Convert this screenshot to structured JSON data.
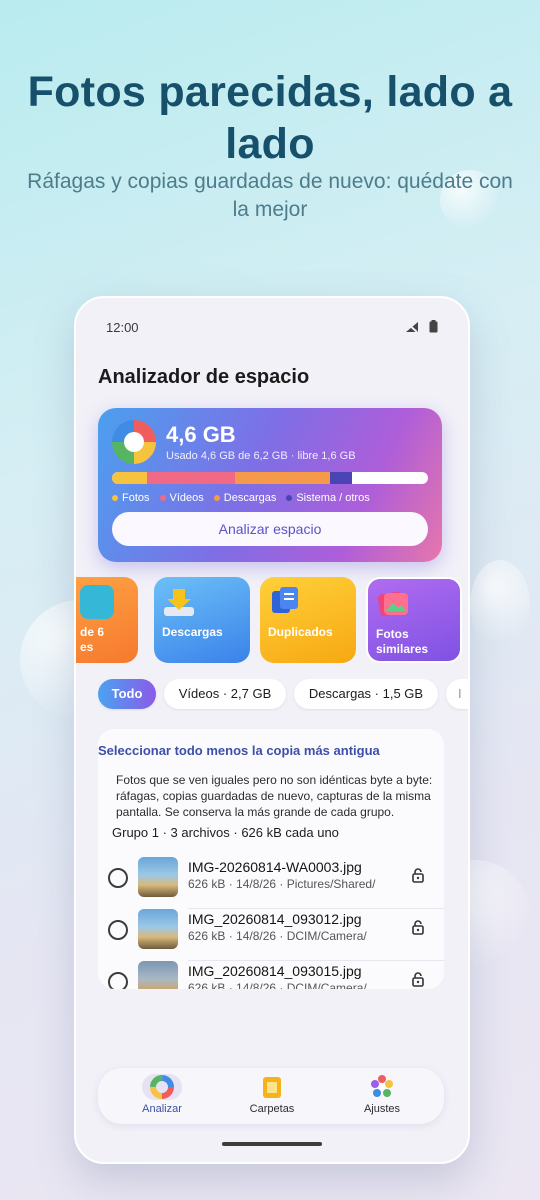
{
  "promo": {
    "headline": "Fotos parecidas, lado a lado",
    "subline": "Ráfagas y copias guardadas de nuevo: quédate con la mejor"
  },
  "status_bar": {
    "time": "12:00",
    "icons": [
      "signal-off-icon",
      "battery-icon"
    ]
  },
  "app": {
    "title": "Analizador de espacio"
  },
  "storage": {
    "total": "4,6 GB",
    "usage_text": "Usado 4,6 GB de 6,2 GB · libre 1,6 GB",
    "analyze_label": "Analizar espacio",
    "segments": [
      {
        "name": "Fotos",
        "color": "#f6c33e",
        "fraction": 0.11
      },
      {
        "name": "Vídeos",
        "color": "#f06a86",
        "fraction": 0.28
      },
      {
        "name": "Descargas",
        "color": "#f59a4a",
        "fraction": 0.3
      },
      {
        "name": "Sistema / otros",
        "color": "#4b44b5",
        "fraction": 0.07
      }
    ]
  },
  "categories": [
    {
      "label": "de 6\nes",
      "icon": "photo-album-icon",
      "color": "#f6923c"
    },
    {
      "label": "Descargas",
      "icon": "download-icon",
      "color": "#4aa3f0"
    },
    {
      "label": "Duplicados",
      "icon": "duplicate-icon",
      "color": "#f8b21f"
    },
    {
      "label": "Fotos\nsimilares",
      "icon": "similar-photos-icon",
      "color": "#9a5fe6"
    }
  ],
  "chips": [
    {
      "label": "Todo",
      "active": true
    },
    {
      "label": "Vídeos · 2,7 GB",
      "active": false
    },
    {
      "label": "Descargas · 1,5 GB",
      "active": false
    },
    {
      "label": "I",
      "active": false
    }
  ],
  "panel": {
    "select_link": "Seleccionar todo menos la copia más antigua",
    "description": "Fotos que se ven iguales pero no son idénticas byte a byte: ráfagas, copias guardadas de nuevo, capturas de la misma pantalla. Se conserva la más grande de cada grupo.",
    "group_title": "Grupo 1 · 3 archivos · 626 kB cada uno",
    "files": [
      {
        "name": "IMG-20260814-WA0003.jpg",
        "meta": "626 kB · 14/8/26 · Pictures/Shared/"
      },
      {
        "name": "IMG_20260814_093012.jpg",
        "meta": "626 kB · 14/8/26 · DCIM/Camera/"
      },
      {
        "name": "IMG_20260814_093015.jpg",
        "meta": "626 kB · 14/8/26 · DCIM/Camera/"
      }
    ]
  },
  "bottom_nav": [
    {
      "label": "Analizar",
      "icon": "analyze-donut-icon",
      "active": true
    },
    {
      "label": "Carpetas",
      "icon": "folder-icon",
      "active": false
    },
    {
      "label": "Ajustes",
      "icon": "settings-flower-icon",
      "active": false
    }
  ]
}
